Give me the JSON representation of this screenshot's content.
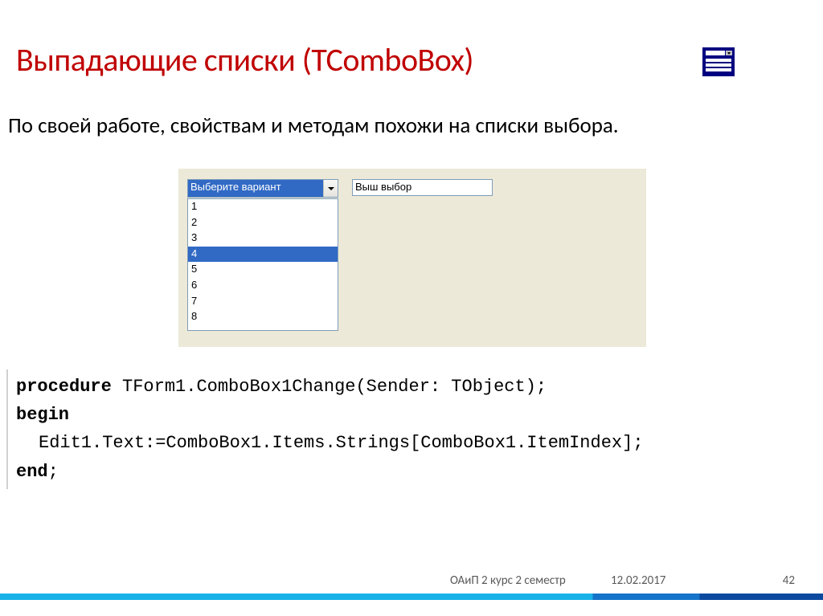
{
  "title": "Выпадающие списки (TComboBox)",
  "body": "По своей работе, свойствам и методам похожи на списки выбора.",
  "form": {
    "combo_text": "Выберите вариант",
    "edit_value": "Выш выбор",
    "items": [
      "1",
      "2",
      "3",
      "4",
      "5",
      "6",
      "7",
      "8"
    ],
    "selected_index": 3
  },
  "code": {
    "lines": [
      {
        "text": "procedure TForm1.ComboBox1Change(Sender: TObject);",
        "bold_prefix": "procedure"
      },
      {
        "text": "begin",
        "bold_prefix": "begin"
      },
      {
        "text": "Edit1.Text:=ComboBox1.Items.Strings[ComboBox1.ItemIndex];",
        "indent": true
      },
      {
        "text": "end;",
        "bold_prefix": "end"
      }
    ]
  },
  "footer": {
    "course": "ОАиП 2 курс 2 семестр",
    "date": "12.02.2017",
    "page": "42"
  }
}
